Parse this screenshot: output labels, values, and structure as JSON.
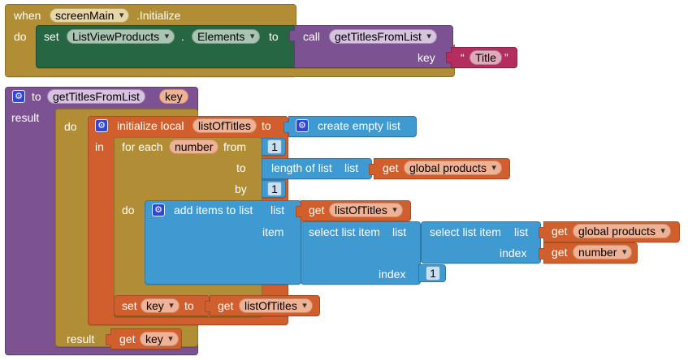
{
  "event_block": {
    "when": "when",
    "component": "screenMain",
    "event": ".Initialize",
    "do": "do",
    "set": "set",
    "target_component": "ListViewProducts",
    "dot": ".",
    "property": "Elements",
    "to": "to",
    "call": "call",
    "procedure": "getTitlesFromList",
    "key_label": "key",
    "open_quote": "“",
    "string_value": "Title",
    "close_quote": "”"
  },
  "procedure_block": {
    "to": "to",
    "name": "getTitlesFromList",
    "param": "key",
    "result": "result",
    "do": "do",
    "init": "initialize local",
    "local_name": "listOfTitles",
    "init_to": "to",
    "create_empty": "create empty list",
    "in": "in",
    "for_each": "for each",
    "loop_var": "number",
    "from": "from",
    "from_value": "1",
    "to_label": "to",
    "length_of_list": "length of list",
    "list_label": "list",
    "get": "get",
    "global_products": "global products",
    "by": "by",
    "by_value": "1",
    "loop_do": "do",
    "add_items": "add items to list",
    "add_list_label": "list",
    "get_list_of_titles": "listOfTitles",
    "item_label": "item",
    "select_outer": "select list item",
    "select_outer_list": "list",
    "select_inner": "select list item",
    "select_inner_list": "list",
    "inner_get_products": "global products",
    "inner_index_label": "index",
    "inner_get_number": "number",
    "outer_index_label": "index",
    "outer_index_value": "1",
    "set": "set",
    "set_var": "key",
    "set_to": "to",
    "set_get_var": "listOfTitles",
    "result_label": "result",
    "result_get_var": "key"
  },
  "icons": {
    "mutator": "gear-icon",
    "dropdown": "chevron-down-icon"
  },
  "colors": {
    "event_gold": "#b18e35",
    "setter_green": "#266643",
    "procedure_purple": "#7d5293",
    "variable_orange": "#d05f2d",
    "list_blue": "#3f9ad2",
    "text_magenta": "#b32d5e"
  }
}
